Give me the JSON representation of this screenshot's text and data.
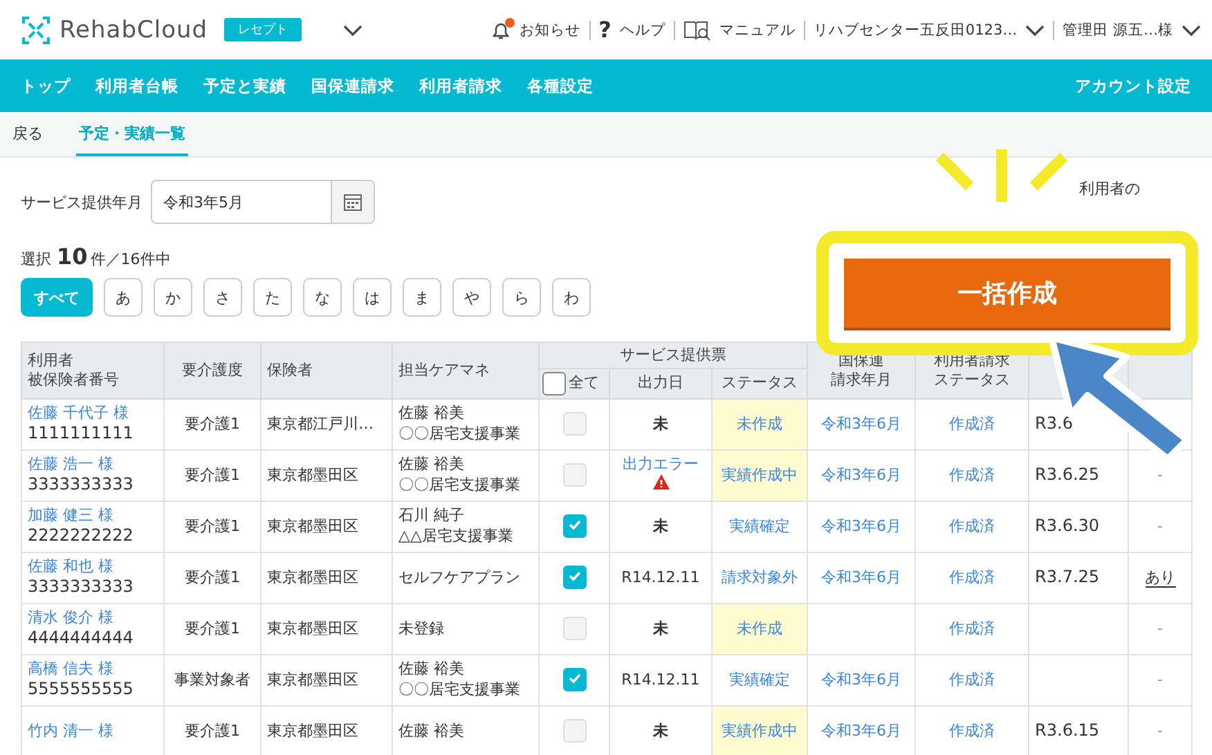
{
  "header": {
    "logo": "RehabCloud",
    "badge": "レセプト",
    "links": [
      {
        "kind": "bell",
        "label": "お知らせ",
        "unread": true
      },
      {
        "kind": "help",
        "icon": "?",
        "label": "ヘルプ"
      },
      {
        "kind": "manual",
        "label": "マニュアル"
      },
      {
        "kind": "menu",
        "label": "リハブセンター五反田0123…"
      },
      {
        "kind": "menu",
        "label": "管理田 源五…様"
      }
    ]
  },
  "nav": {
    "items": [
      "トップ",
      "利用者台帳",
      "予定と実績",
      "国保連請求",
      "利用者請求",
      "各種設定"
    ],
    "account": "アカウント設定"
  },
  "subtabs": [
    {
      "label": "戻る",
      "selected": false
    },
    {
      "label": "予定・実績一覧",
      "selected": true
    }
  ],
  "filter": {
    "label": "サービス提供年月",
    "value": "令和3年5月"
  },
  "note": "利用者の",
  "selection": {
    "prefix": "選択",
    "count": "10",
    "suffix": "件／16件中"
  },
  "kana": [
    {
      "label": "すべて",
      "selected": true
    },
    {
      "label": "あ",
      "selected": false
    },
    {
      "label": "か",
      "selected": false
    },
    {
      "label": "さ",
      "selected": false
    },
    {
      "label": "た",
      "selected": false
    },
    {
      "label": "な",
      "selected": false
    },
    {
      "label": "は",
      "selected": false
    },
    {
      "label": "ま",
      "selected": false
    },
    {
      "label": "や",
      "selected": false
    },
    {
      "label": "ら",
      "selected": false
    },
    {
      "label": "わ",
      "selected": false
    }
  ],
  "bulk_button": "一括作成",
  "table": {
    "columns": [
      [
        "利用者",
        "被保険者番号"
      ],
      [
        "要介護度"
      ],
      [
        "保険者"
      ],
      [
        "担当ケアマネ"
      ]
    ],
    "group": "サービス提供票",
    "select_all": {
      "label": "全て",
      "checked": false
    },
    "sub_columns": [
      "出力日",
      "ステータス"
    ],
    "columns_right": [
      [
        "国保連",
        "請求年月"
      ],
      [
        "利用者請求",
        "ステータス"
      ]
    ],
    "rows": [
      {
        "name": "佐藤 千代子 様",
        "number": "1111111111",
        "care": "要介護1",
        "insurer": "東京都江戸川…",
        "manager": [
          "佐藤 裕美",
          "〇〇居宅支援事業"
        ],
        "checked": false,
        "disabled": true,
        "output": "未",
        "output_error": false,
        "status": "未作成",
        "pending": true,
        "billing_month": "令和3年6月",
        "user_status": "作成済",
        "date": "R3.6",
        "extra": ""
      },
      {
        "name": "佐藤 浩一 様",
        "number": "3333333333",
        "care": "要介護1",
        "insurer": "東京都墨田区",
        "manager": [
          "佐藤 裕美",
          "〇〇居宅支援事業"
        ],
        "checked": false,
        "disabled": true,
        "output": "出力エラー",
        "output_error": true,
        "status": "実績作成中",
        "pending": true,
        "billing_month": "令和3年6月",
        "user_status": "作成済",
        "date": "R3.6.25",
        "extra": "-"
      },
      {
        "name": "加藤 健三 様",
        "number": "2222222222",
        "care": "要介護1",
        "insurer": "東京都墨田区",
        "manager": [
          "石川 純子",
          "△△居宅支援事業"
        ],
        "checked": true,
        "disabled": false,
        "output": "未",
        "output_error": false,
        "status": "実績確定",
        "pending": false,
        "billing_month": "令和3年6月",
        "user_status": "作成済",
        "date": "R3.6.30",
        "extra": "-"
      },
      {
        "name": "佐藤 和也 様",
        "number": "3333333333",
        "care": "要介護1",
        "insurer": "東京都墨田区",
        "manager": [
          "セルフケアプラン"
        ],
        "checked": true,
        "disabled": false,
        "output": "R14.12.11",
        "output_error": false,
        "status": "請求対象外",
        "pending": false,
        "billing_month": "令和3年6月",
        "user_status": "作成済",
        "date": "R3.7.25",
        "extra": "あり"
      },
      {
        "name": "清水 俊介 様",
        "number": "4444444444",
        "care": "要介護1",
        "insurer": "東京都墨田区",
        "manager": [
          "未登録"
        ],
        "checked": false,
        "disabled": true,
        "output": "未",
        "output_error": false,
        "status": "未作成",
        "pending": true,
        "billing_month": "",
        "user_status": "作成済",
        "date": "",
        "extra": "-"
      },
      {
        "name": "高橋 信夫 様",
        "number": "5555555555",
        "care": "事業対象者",
        "insurer": "東京都墨田区",
        "manager": [
          "佐藤 裕美",
          "〇〇居宅支援事業"
        ],
        "checked": true,
        "disabled": false,
        "output": "R14.12.11",
        "output_error": false,
        "status": "実績確定",
        "pending": false,
        "billing_month": "令和3年6月",
        "user_status": "作成済",
        "date": "",
        "extra": "-"
      },
      {
        "name": "竹内 清一 様",
        "number": "",
        "care": "要介護1",
        "insurer": "東京都墨田区",
        "manager": [
          "佐藤 裕美"
        ],
        "checked": false,
        "disabled": true,
        "output": "未",
        "output_error": false,
        "status": "実績作成中",
        "pending": true,
        "billing_month": "令和3年6月",
        "user_status": "作成済",
        "date": "R3.6.15",
        "extra": "-"
      }
    ]
  }
}
